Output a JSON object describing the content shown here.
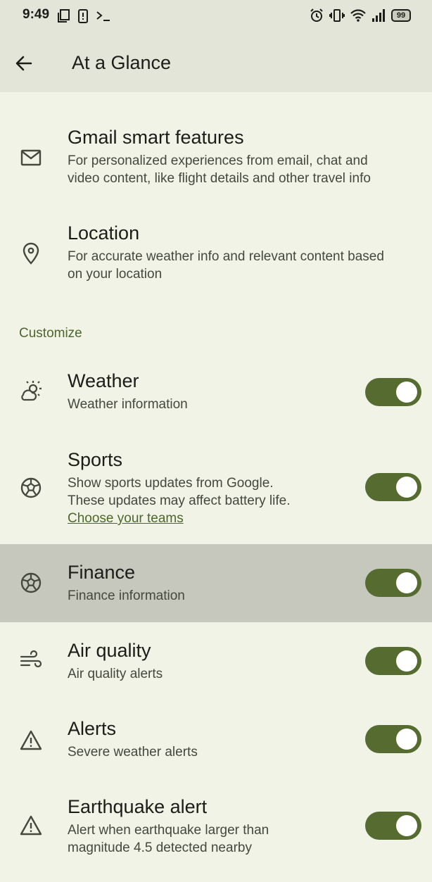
{
  "status_bar": {
    "time": "9:49",
    "battery": "99"
  },
  "app_bar": {
    "title": "At a Glance"
  },
  "accounts": [
    {
      "title": "Gmail smart features",
      "subtitle_lines": [
        "For personalized experiences from email, chat and",
        "video content, like flight details and other travel info"
      ],
      "icon": "mail-icon"
    },
    {
      "title": "Location",
      "subtitle_lines": [
        "For accurate weather info and relevant content based",
        "on your location"
      ],
      "icon": "location-pin-icon"
    }
  ],
  "section": {
    "customize": "Customize"
  },
  "items": [
    {
      "title": "Weather",
      "subtitle_lines": [
        "Weather information"
      ],
      "icon": "weather-icon",
      "enabled": true
    },
    {
      "title": "Sports",
      "subtitle_lines": [
        "Show sports updates from Google.",
        "These updates may affect battery life."
      ],
      "link": "Choose your teams",
      "icon": "soccer-ball-icon",
      "enabled": true
    },
    {
      "title": "Finance",
      "subtitle_lines": [
        "Finance information"
      ],
      "icon": "soccer-ball-icon",
      "enabled": true
    },
    {
      "title": "Air quality",
      "subtitle_lines": [
        "Air quality alerts"
      ],
      "icon": "wind-icon",
      "enabled": true
    },
    {
      "title": "Alerts",
      "subtitle_lines": [
        "Severe weather alerts"
      ],
      "icon": "warning-icon",
      "enabled": true
    },
    {
      "title": "Earthquake alert",
      "subtitle_lines": [
        "Alert when earthquake larger than",
        "magnitude 4.5 detected nearby"
      ],
      "icon": "warning-icon",
      "enabled": true
    }
  ],
  "colors": {
    "accent": "#4c662b",
    "toggle_track": "#556b2f",
    "background": "#f1f3e7",
    "highlight": "#c6c8bd"
  }
}
